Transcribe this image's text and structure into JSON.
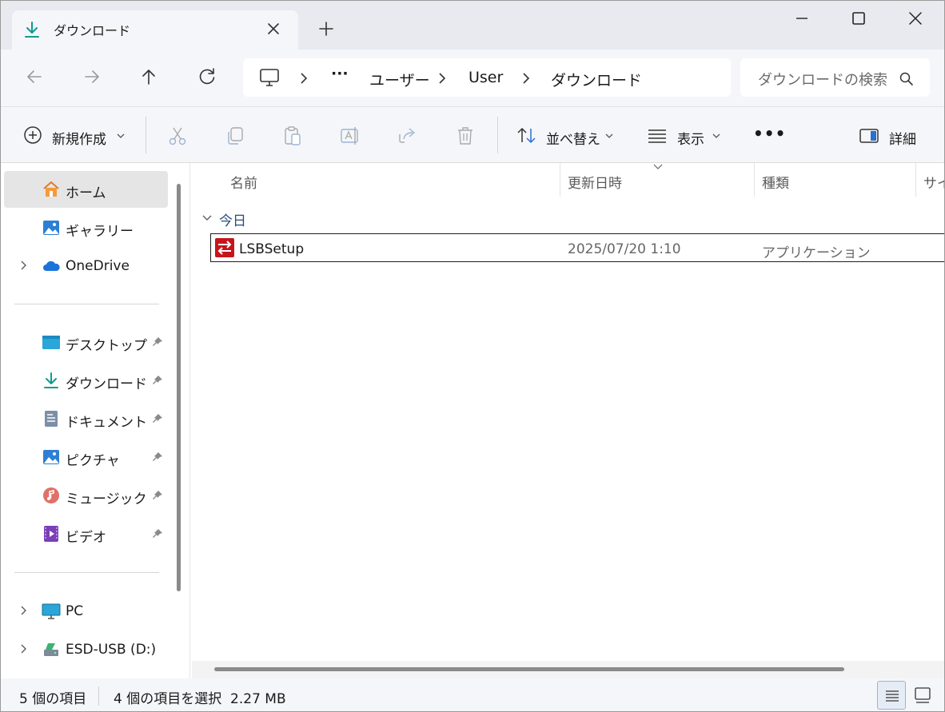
{
  "tab": {
    "title": "ダウンロード"
  },
  "address": {
    "ellipsis": "···",
    "crumbs": [
      "ユーザー",
      "User",
      "ダウンロード"
    ]
  },
  "search": {
    "placeholder": "ダウンロードの検索"
  },
  "toolbar": {
    "new_label": "新規作成",
    "sort_label": "並べ替え",
    "view_label": "表示",
    "more_label": "•••",
    "details_label": "詳細"
  },
  "sidebar": {
    "items": [
      {
        "label": "ホーム",
        "icon": "home-icon"
      },
      {
        "label": "ギャラリー",
        "icon": "gallery-icon"
      },
      {
        "label": "OneDrive",
        "icon": "onedrive-icon"
      },
      {
        "label": "デスクトップ",
        "icon": "desktop-icon"
      },
      {
        "label": "ダウンロード",
        "icon": "download-icon"
      },
      {
        "label": "ドキュメント",
        "icon": "documents-icon"
      },
      {
        "label": "ピクチャ",
        "icon": "pictures-icon"
      },
      {
        "label": "ミュージック",
        "icon": "music-icon"
      },
      {
        "label": "ビデオ",
        "icon": "video-icon"
      },
      {
        "label": "PC",
        "icon": "pc-icon"
      },
      {
        "label": "ESD-USB (D:)",
        "icon": "usb-drive-icon"
      }
    ]
  },
  "columns": {
    "name": "名前",
    "modified": "更新日時",
    "type": "種類",
    "size": "サイ"
  },
  "group": {
    "label": "今日"
  },
  "files": [
    {
      "name": "LSBSetup",
      "modified": "2025/07/20 1:10",
      "type": "アプリケーション"
    }
  ],
  "status": {
    "count": "5 個の項目",
    "selected": "4 個の項目を選択  2.27 MB"
  },
  "colors": {
    "accent": "#0f7b6c",
    "app_icon_red": "#c4161c",
    "folder_blue": "#1e88e5"
  }
}
